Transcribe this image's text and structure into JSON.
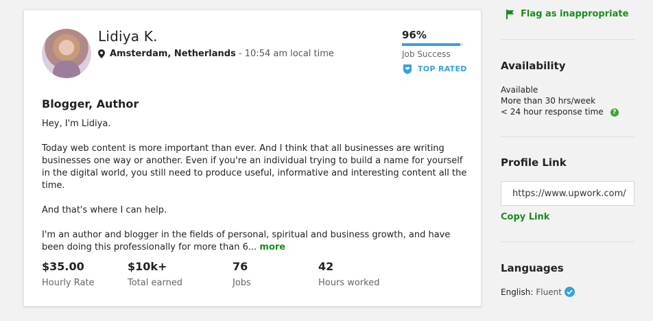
{
  "profile": {
    "name": "Lidiya K.",
    "location": "Amsterdam, Netherlands",
    "separator": " - ",
    "local_time": "10:54 am local time",
    "job_success_pct": "96%",
    "job_success_value": 0.96,
    "job_success_label": "Job Success",
    "badge": "TOP RATED",
    "title": "Blogger, Author",
    "overview": [
      "Hey, I'm Lidiya.",
      "Today web content is more important than ever. And I think that all businesses are writing businesses one way or another. Even if you're an individual trying to build a name for yourself in the digital world, you still need to produce useful, informative and interesting content all the time.",
      "And that's where I can help.",
      "I'm an author and blogger in the fields of personal, spiritual and business growth, and have been doing this professionally for more than 6..."
    ],
    "more_label": "more",
    "stats": [
      {
        "value": "$35.00",
        "label": "Hourly Rate"
      },
      {
        "value": "$10k+",
        "label": "Total earned"
      },
      {
        "value": "76",
        "label": "Jobs"
      },
      {
        "value": "42",
        "label": "Hours worked"
      }
    ]
  },
  "sidebar": {
    "flag_label": "Flag as inappropriate",
    "availability_title": "Availability",
    "availability_status": "Available",
    "availability_hours": "More than 30 hrs/week",
    "response_time": "< 24 hour response time",
    "help_icon_glyph": "?",
    "profile_link_title": "Profile Link",
    "profile_link_value": "https://www.upwork.com/",
    "copy_link_label": "Copy Link",
    "languages_title": "Languages",
    "language": "English:",
    "language_level": "Fluent"
  },
  "colors": {
    "accent_green": "#1a8d1a",
    "accent_blue": "#37a0e0"
  }
}
